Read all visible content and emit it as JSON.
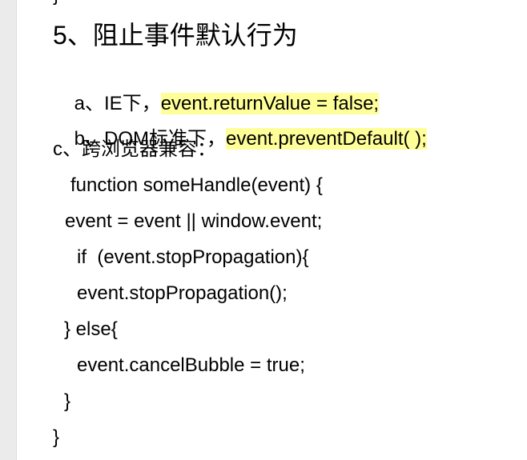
{
  "document": {
    "fragment_above": "}",
    "heading": "5、阻止事件默认行为",
    "items": [
      {
        "prefix": "a、IE下，",
        "code": "event.returnValue = false;"
      },
      {
        "prefix": "b、DOM标准下，",
        "code": "event.preventDefault( );"
      },
      {
        "text": "c、跨浏览器兼容："
      }
    ],
    "code_lines": [
      "function someHandle(event) {",
      "event = event || window.event;",
      "if  (event.stopPropagation){",
      "event.stopPropagation();",
      "} else{",
      "event.cancelBubble = true;",
      "}",
      "}"
    ]
  },
  "colors": {
    "highlight": "#ffff99",
    "gutter": "#ebebeb"
  }
}
